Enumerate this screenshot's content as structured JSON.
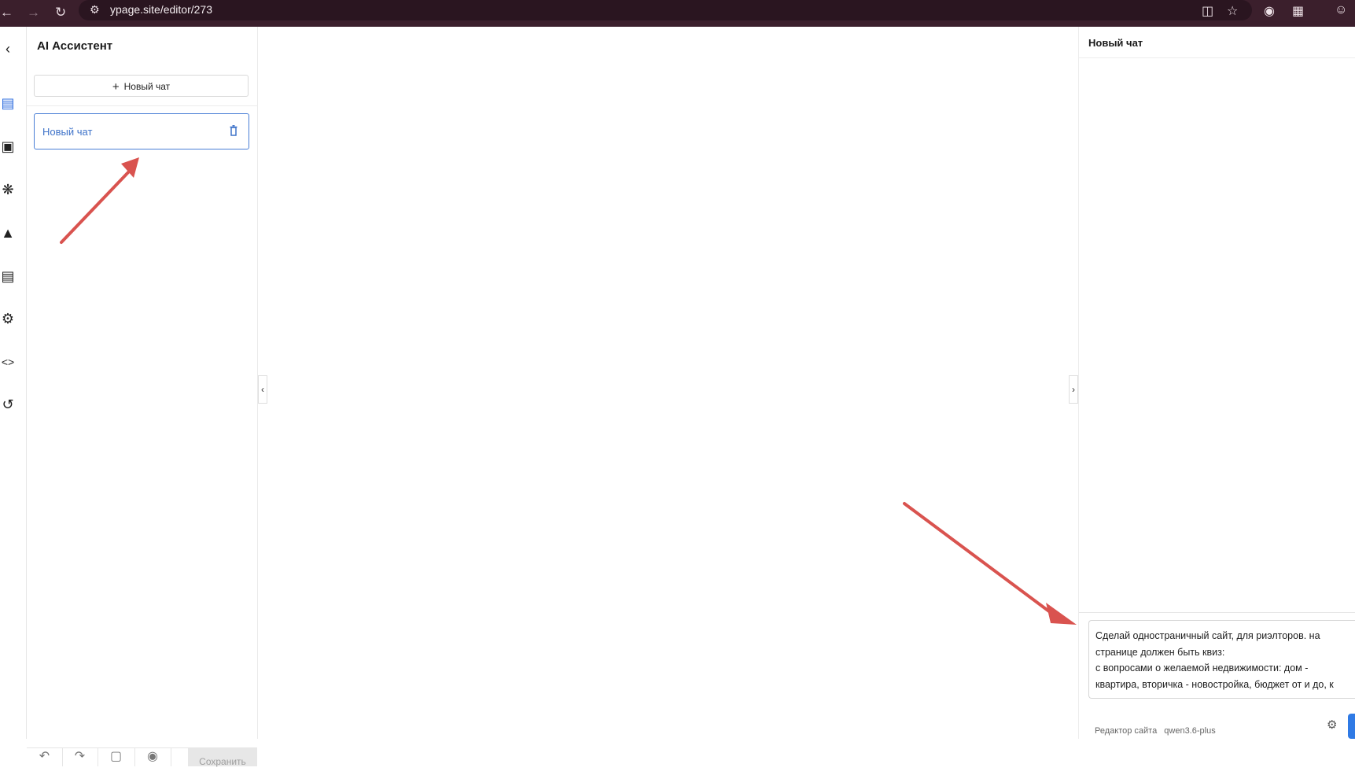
{
  "browser": {
    "url": "ypage.site/editor/273",
    "back_icon": "arrow-left-icon",
    "forward_icon": "arrow-right-icon",
    "reload_icon": "reload-icon"
  },
  "sidebar": {
    "rail_icons": [
      "chevron-left-icon",
      "chat-icon",
      "image-icon",
      "puzzle-icon",
      "palette-icon",
      "document-icon",
      "gear-icon",
      "code-icon",
      "history-icon"
    ]
  },
  "assistant": {
    "title": "AI Ассистент",
    "new_chat_label": "Новый чат",
    "chats": [
      {
        "label": "Новый чат"
      }
    ],
    "save_label": "Сохранить"
  },
  "chat_panel": {
    "title": "Новый чат",
    "prompt_text": "Сделай одностраничный сайт, для риэлторов. на\nстранице должен быть квиз:\nс вопросами о желаемой недвижимости: дом -\nквартира, вторичка - новостройка, бюджет от и до, к",
    "footer_mode": "Редактор сайта",
    "footer_model": "qwen3.6-plus"
  },
  "colors": {
    "browser_bar": "#3b1f2c",
    "accent": "#2d6cdf",
    "arrow": "#d9534f"
  }
}
